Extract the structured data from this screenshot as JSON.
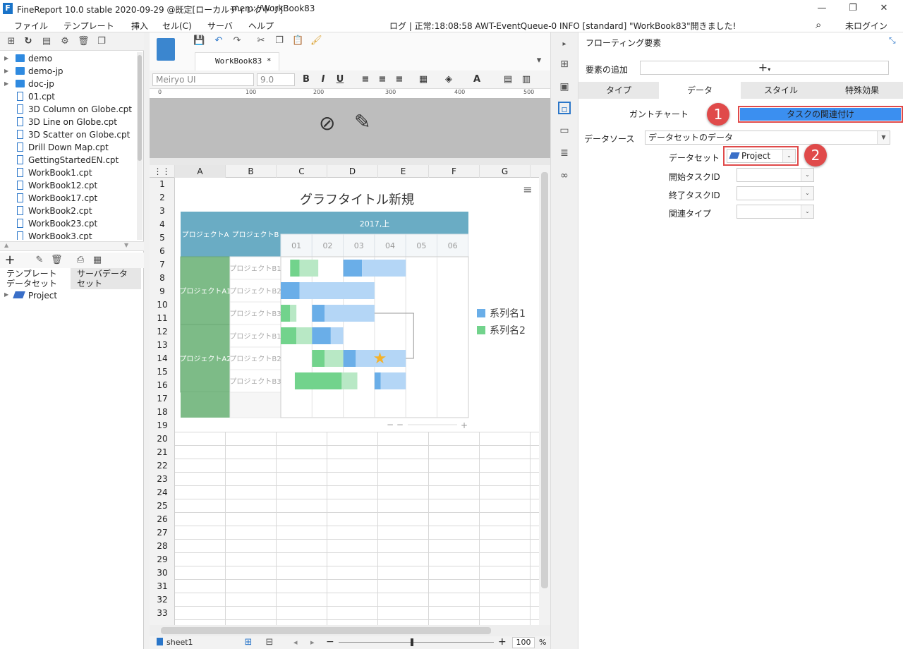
{
  "app": {
    "title": "FineReport 10.0 stable 2020-09-29 @既定[ローカルディレクトリ]",
    "path": "mem://WorkBook83",
    "logo_letter": "F"
  },
  "menu": {
    "items": [
      "ファイル",
      "テンプレート",
      "挿入",
      "セル(C)",
      "サーバ",
      "ヘルプ"
    ],
    "log": "ログ | 正常:18:08:58 AWT-EventQueue-0 INFO [standard] \"WorkBook83\"開きました!",
    "login": "未ログイン"
  },
  "tree": {
    "items": [
      {
        "label": "demo",
        "type": "folder"
      },
      {
        "label": "demo-jp",
        "type": "folder"
      },
      {
        "label": "doc-jp",
        "type": "folder"
      },
      {
        "label": "01.cpt",
        "type": "file"
      },
      {
        "label": "3D Column on Globe.cpt",
        "type": "file"
      },
      {
        "label": "3D Line on Globe.cpt",
        "type": "file"
      },
      {
        "label": "3D Scatter on Globe.cpt",
        "type": "file"
      },
      {
        "label": "Drill Down Map.cpt",
        "type": "file"
      },
      {
        "label": "GettingStartedEN.cpt",
        "type": "file"
      },
      {
        "label": "WorkBook1.cpt",
        "type": "file"
      },
      {
        "label": "WorkBook12.cpt",
        "type": "file"
      },
      {
        "label": "WorkBook17.cpt",
        "type": "file"
      },
      {
        "label": "WorkBook2.cpt",
        "type": "file"
      },
      {
        "label": "WorkBook23.cpt",
        "type": "file"
      },
      {
        "label": "WorkBook3.cpt",
        "type": "file"
      }
    ]
  },
  "dataset_panel": {
    "tab_template": "テンプレート\nデータセット",
    "tab_server": "サーバデータ\nセット",
    "item": "Project"
  },
  "editor": {
    "tab_label": "WorkBook83 *",
    "font": "Meiryo UI",
    "size": "9.0",
    "ruler": [
      "0",
      "100",
      "200",
      "300",
      "400",
      "500"
    ],
    "columns": [
      "A",
      "B",
      "C",
      "D",
      "E",
      "F",
      "G"
    ],
    "rows": [
      "1",
      "2",
      "3",
      "4",
      "5",
      "6",
      "7",
      "8",
      "9",
      "10",
      "11",
      "12",
      "13",
      "14",
      "15",
      "16",
      "17",
      "18",
      "19",
      "20",
      "21",
      "22",
      "23",
      "24",
      "25",
      "26",
      "27",
      "28",
      "29",
      "30",
      "31",
      "32",
      "33"
    ],
    "sheet": "sheet1",
    "zoom": "100",
    "zoom_unit": "%"
  },
  "chart_data": {
    "type": "gantt",
    "title": "グラフタイトル新規",
    "header_a": "プロジェクトA",
    "header_b": "プロジェクトB",
    "period": "2017,上",
    "periods": [
      "01",
      "02",
      "03",
      "04",
      "05",
      "06"
    ],
    "groups": [
      "プロジェクトA1",
      "プロジェクトA2"
    ],
    "tasks": [
      "プロジェクトB1",
      "プロジェクトB2",
      "プロジェクトB3",
      "プロジェクトB1",
      "プロジェクトB2",
      "プロジェクトB3"
    ],
    "series": [
      {
        "name": "系列名1",
        "color": "#6aaee8"
      },
      {
        "name": "系列名2",
        "color": "#72d38c"
      }
    ]
  },
  "rpanel": {
    "title": "フローティング要素",
    "add_label": "要素の追加",
    "add_symbol": "+",
    "tabs": [
      "タイプ",
      "データ",
      "スタイル",
      "特殊効果"
    ],
    "subtabs": [
      "ガントチャート",
      "タスクの関連付け"
    ],
    "datasource_label": "データソース",
    "datasource_value": "データセットのデータ",
    "dataset_label": "データセット",
    "dataset_value": "Project",
    "start_label": "開始タスクID",
    "end_label": "終了タスクID",
    "rel_label": "関連タイプ",
    "badge1": "1",
    "badge2": "2"
  },
  "colors": {
    "accent": "#3b8ff0",
    "badge": "#e04a4a",
    "header_teal": "#6aacc4",
    "group_green": "#7dbb87"
  }
}
